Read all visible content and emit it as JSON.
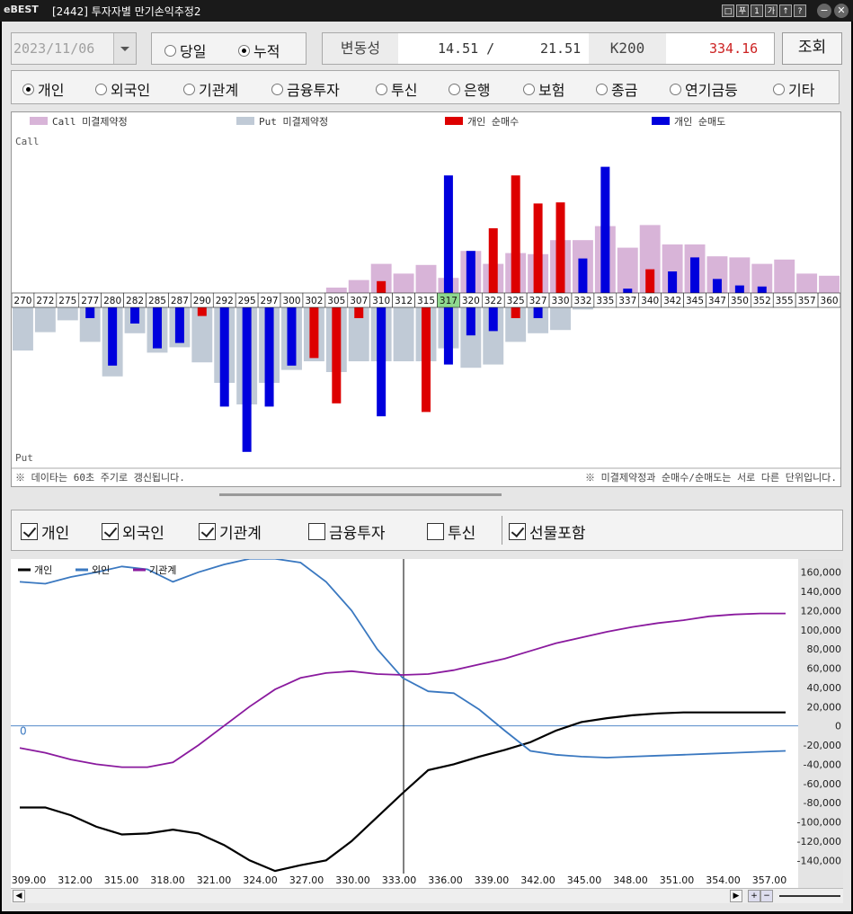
{
  "window": {
    "logo": "eBEST",
    "title": "[2442] 투자자별 만기손익추정2",
    "buttons": [
      "□",
      "푸",
      "1",
      "가",
      "↑",
      "?"
    ]
  },
  "toolbar": {
    "date": "2023/11/06",
    "period_options": [
      {
        "label": "당일",
        "selected": false
      },
      {
        "label": "누적",
        "selected": true
      }
    ],
    "volatility_label": "변동성",
    "volatility_value1": "14.51 /",
    "volatility_value2": "21.51",
    "k200_label": "K200",
    "k200_value": "334.16",
    "lookup_label": "조회"
  },
  "investors": [
    {
      "label": "개인",
      "selected": true
    },
    {
      "label": "외국인",
      "selected": false
    },
    {
      "label": "기관계",
      "selected": false
    },
    {
      "label": "금융투자",
      "selected": false
    },
    {
      "label": "투신",
      "selected": false
    },
    {
      "label": "은행",
      "selected": false
    },
    {
      "label": "보험",
      "selected": false
    },
    {
      "label": "종금",
      "selected": false
    },
    {
      "label": "연기금등",
      "selected": false
    },
    {
      "label": "기타",
      "selected": false
    }
  ],
  "colors": {
    "call_oi": "#d8b4d8",
    "put_oi": "#c0cad6",
    "net_buy": "#dd0000",
    "net_sell": "#0000dd",
    "atm_strike": "#8ed88e",
    "retail_line": "#000000",
    "foreign_line": "#3a78c0",
    "inst_line": "#8a1a9e",
    "k200_value": "#cc2222"
  },
  "chart_data": [
    {
      "type": "bar",
      "legend": [
        "Call 미결제약정",
        "Put 미결제약정",
        "개인 순매수",
        "개인 순매도"
      ],
      "call_label": "Call",
      "put_label": "Put",
      "atm_strike": "317",
      "categories": [
        "270",
        "272",
        "275",
        "277",
        "280",
        "282",
        "285",
        "287",
        "290",
        "292",
        "295",
        "297",
        "300",
        "302",
        "305",
        "307",
        "310",
        "312",
        "315",
        "317",
        "320",
        "322",
        "325",
        "327",
        "330",
        "332",
        "335",
        "337",
        "340",
        "342",
        "345",
        "347",
        "350",
        "352",
        "355",
        "357",
        "360"
      ],
      "call_oi": [
        0,
        0,
        0,
        0,
        0,
        0,
        0,
        0,
        0,
        0,
        0,
        0,
        0,
        0,
        5,
        12,
        27,
        18,
        26,
        14,
        39,
        27,
        37,
        36,
        49,
        49,
        62,
        42,
        63,
        45,
        45,
        34,
        33,
        27,
        31,
        18,
        16
      ],
      "call_individual": [
        0,
        0,
        0,
        0,
        0,
        0,
        0,
        0,
        0,
        0,
        0,
        0,
        0,
        0,
        0,
        0,
        11,
        0,
        0,
        109,
        39,
        60,
        109,
        83,
        84,
        32,
        117,
        4,
        22,
        20,
        33,
        13,
        7,
        6,
        0,
        0,
        0
      ],
      "put_oi": [
        40,
        23,
        12,
        32,
        64,
        24,
        42,
        37,
        51,
        70,
        90,
        70,
        58,
        50,
        60,
        50,
        50,
        50,
        50,
        38,
        56,
        53,
        32,
        24,
        21,
        2,
        0,
        0,
        0,
        0,
        0,
        0,
        0,
        0,
        0,
        0,
        0
      ],
      "put_individual": [
        0,
        0,
        0,
        10,
        54,
        15,
        38,
        33,
        8,
        92,
        134,
        92,
        54,
        47,
        89,
        10,
        101,
        0,
        97,
        53,
        26,
        22,
        10,
        10,
        0,
        0,
        0,
        0,
        0,
        0,
        0,
        0,
        0,
        0,
        0,
        0,
        0
      ],
      "net_direction": [
        "sell",
        "sell",
        "sell",
        "sell",
        "sell",
        "sell",
        "sell",
        "sell",
        "buy",
        "sell",
        "sell",
        "sell",
        "sell",
        "buy",
        "buy",
        "buy",
        "sell",
        "buy",
        "buy",
        "sell",
        "sell",
        "sell",
        "buy",
        "sell",
        "buy",
        "sell",
        "sell",
        "sell",
        "buy",
        "sell",
        "sell",
        "sell",
        "sell",
        "sell",
        "sell",
        "sell",
        "sell"
      ],
      "call_direction": [
        "sell",
        "sell",
        "sell",
        "sell",
        "sell",
        "sell",
        "sell",
        "sell",
        "sell",
        "sell",
        "sell",
        "sell",
        "sell",
        "sell",
        "sell",
        "sell",
        "buy",
        "sell",
        "sell",
        "sell",
        "sell",
        "buy",
        "buy",
        "buy",
        "buy",
        "sell",
        "sell",
        "sell",
        "buy",
        "sell",
        "sell",
        "sell",
        "sell",
        "sell",
        "sell",
        "sell",
        "sell"
      ],
      "footnote_left": "※ 데이타는 60초 주기로 갱신됩니다.",
      "footnote_right": "※ 미결제약정과 순매수/순매도는 서로 다른 단위입니다."
    },
    {
      "type": "line",
      "series": [
        {
          "name": "개인",
          "values": [
            -85000,
            -85000,
            -93000,
            -105000,
            -113000,
            -112000,
            -108000,
            -112000,
            -124000,
            -140000,
            -151000,
            -145000,
            -140000,
            -120000,
            -95000,
            -70000,
            -46000,
            -40000,
            -32000,
            -25000,
            -17000,
            -5000,
            4000,
            8000,
            11000,
            13000,
            14000,
            14000,
            14000,
            14000,
            14000
          ]
        },
        {
          "name": "외인",
          "values": [
            150000,
            148000,
            155000,
            160000,
            166000,
            163000,
            150000,
            160000,
            168000,
            174000,
            174000,
            170000,
            150000,
            120000,
            80000,
            50000,
            36000,
            34000,
            17000,
            -5000,
            -26000,
            -30000,
            -32000,
            -33000,
            -32000,
            -31000,
            -30000,
            -29000,
            -28000,
            -27000,
            -26000
          ]
        },
        {
          "name": "기관계",
          "values": [
            -23000,
            -28000,
            -35000,
            -40000,
            -43000,
            -43000,
            -38000,
            -20000,
            0,
            20000,
            38000,
            50000,
            55000,
            57000,
            54000,
            53000,
            54000,
            58000,
            64000,
            70000,
            78000,
            86000,
            92000,
            98000,
            103000,
            107000,
            110000,
            114000,
            116000,
            117000,
            117000
          ]
        }
      ],
      "x": [
        309,
        310,
        311,
        312,
        313,
        314,
        315,
        316,
        317,
        318,
        319,
        320,
        321,
        322,
        323,
        324,
        325,
        326,
        327,
        328,
        329,
        330,
        331,
        332,
        333,
        334,
        335,
        336,
        337,
        338,
        339
      ],
      "x_tick_labels": [
        "309.00",
        "312.00",
        "315.00",
        "318.00",
        "321.00",
        "324.00",
        "327.00",
        "330.00",
        "333.00",
        "336.00",
        "339.00",
        "342.00",
        "345.00",
        "348.00",
        "351.00",
        "354.00",
        "357.00"
      ],
      "y_tick_labels": [
        "160,000",
        "140,000",
        "120,000",
        "100,000",
        "80,000",
        "60,000",
        "40,000",
        "20,000",
        "0",
        "-20,000",
        "-40,000",
        "-60,000",
        "-80,000",
        "-100,000",
        "-120,000",
        "-140,000"
      ],
      "zero_label": "0",
      "ylim": [
        -150000,
        170000
      ]
    }
  ],
  "filters": [
    {
      "label": "개인",
      "checked": true
    },
    {
      "label": "외국인",
      "checked": true
    },
    {
      "label": "기관계",
      "checked": true
    },
    {
      "label": "금융투자",
      "checked": false
    },
    {
      "label": "투신",
      "checked": false
    },
    {
      "label": "선물포함",
      "checked": true
    }
  ]
}
